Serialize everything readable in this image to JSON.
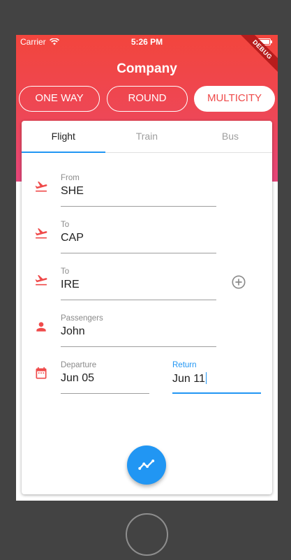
{
  "status_bar": {
    "carrier": "Carrier",
    "time": "5:26 PM",
    "banner": "DEBUG"
  },
  "app": {
    "title": "Company"
  },
  "trip_types": [
    {
      "label": "ONE WAY",
      "active": false
    },
    {
      "label": "ROUND",
      "active": false
    },
    {
      "label": "MULTICITY",
      "active": true
    }
  ],
  "tabs": [
    {
      "label": "Flight",
      "active": true
    },
    {
      "label": "Train",
      "active": false
    },
    {
      "label": "Bus",
      "active": false
    }
  ],
  "form": {
    "from": {
      "label": "From",
      "value": "SHE"
    },
    "to1": {
      "label": "To",
      "value": "CAP"
    },
    "to2": {
      "label": "To",
      "value": "IRE"
    },
    "passengers": {
      "label": "Passengers",
      "value": "John"
    },
    "departure": {
      "label": "Departure",
      "value": "Jun 05"
    },
    "return": {
      "label": "Return",
      "value": "Jun 11"
    }
  },
  "icons": {
    "takeoff": "flight-takeoff-icon",
    "person": "person-icon",
    "calendar": "calendar-icon",
    "add": "add-circle-outline-icon",
    "fab": "timeline-icon",
    "wifi": "wifi-icon"
  },
  "colors": {
    "accent": "#ef4a4a",
    "primary": "#2196f3",
    "gradient_top": "#f2453d",
    "gradient_bottom": "#e5457a"
  }
}
